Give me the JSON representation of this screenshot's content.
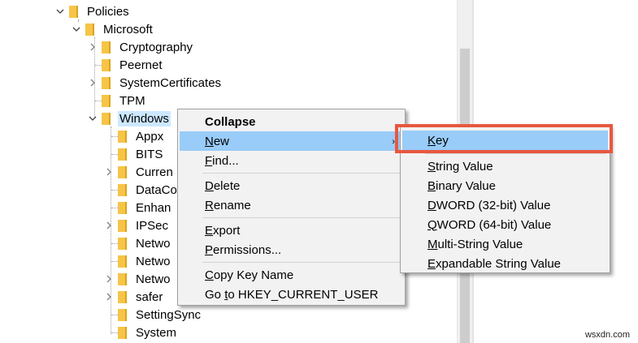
{
  "tree": {
    "nodes": [
      {
        "label": "Policies",
        "expander": "down"
      },
      {
        "label": "Microsoft",
        "expander": "down"
      },
      {
        "label": "Cryptography",
        "expander": "right"
      },
      {
        "label": "Peernet",
        "expander": "none"
      },
      {
        "label": "SystemCertificates",
        "expander": "right"
      },
      {
        "label": "TPM",
        "expander": "none"
      },
      {
        "label": "Windows",
        "expander": "down",
        "selected": true
      },
      {
        "label": "Appx",
        "expander": "none"
      },
      {
        "label": "BITS",
        "expander": "none"
      },
      {
        "label": "Curren",
        "expander": "right"
      },
      {
        "label": "DataCo",
        "expander": "none"
      },
      {
        "label": "Enhan",
        "expander": "none"
      },
      {
        "label": "IPSec",
        "expander": "right"
      },
      {
        "label": "Netwo",
        "expander": "none"
      },
      {
        "label": "Netwo",
        "expander": "none"
      },
      {
        "label": "Netwo",
        "expander": "right"
      },
      {
        "label": "safer",
        "expander": "right"
      },
      {
        "label": "SettingSync",
        "expander": "none"
      },
      {
        "label": "System",
        "expander": "none"
      }
    ]
  },
  "context_menu": {
    "collapse": "Collapse",
    "new_pre": "",
    "new_u": "N",
    "new_post": "ew",
    "find_pre": "",
    "find_u": "F",
    "find_post": "ind...",
    "delete_pre": "",
    "delete_u": "D",
    "delete_post": "elete",
    "rename_pre": "",
    "rename_u": "R",
    "rename_post": "ename",
    "export_pre": "",
    "export_u": "E",
    "export_post": "xport",
    "permissions_pre": "",
    "permissions_u": "P",
    "permissions_post": "ermissions...",
    "copy_pre": "",
    "copy_u": "C",
    "copy_post": "opy Key Name",
    "goto_pre": "Go ",
    "goto_u": "t",
    "goto_post": "o HKEY_CURRENT_USER",
    "submenu_arrow": "›"
  },
  "submenu": {
    "key_pre": "",
    "key_u": "K",
    "key_post": "ey",
    "string_pre": "",
    "string_u": "S",
    "string_post": "tring Value",
    "binary_pre": "",
    "binary_u": "B",
    "binary_post": "inary Value",
    "dword_pre": "",
    "dword_u": "D",
    "dword_post": "WORD (32-bit) Value",
    "qword_pre": "",
    "qword_u": "Q",
    "qword_post": "WORD (64-bit) Value",
    "multi_pre": "",
    "multi_u": "M",
    "multi_post": "ulti-String Value",
    "expand_pre": "",
    "expand_u": "E",
    "expand_post": "xpandable String Value"
  },
  "watermark": "wsxdn.com",
  "colors": {
    "menu_bg": "#f2f2f2",
    "menu_highlight": "#99ccf8",
    "annotation_box": "#e8573f",
    "folder": "#f6c548",
    "selection": "#cce8ff"
  }
}
